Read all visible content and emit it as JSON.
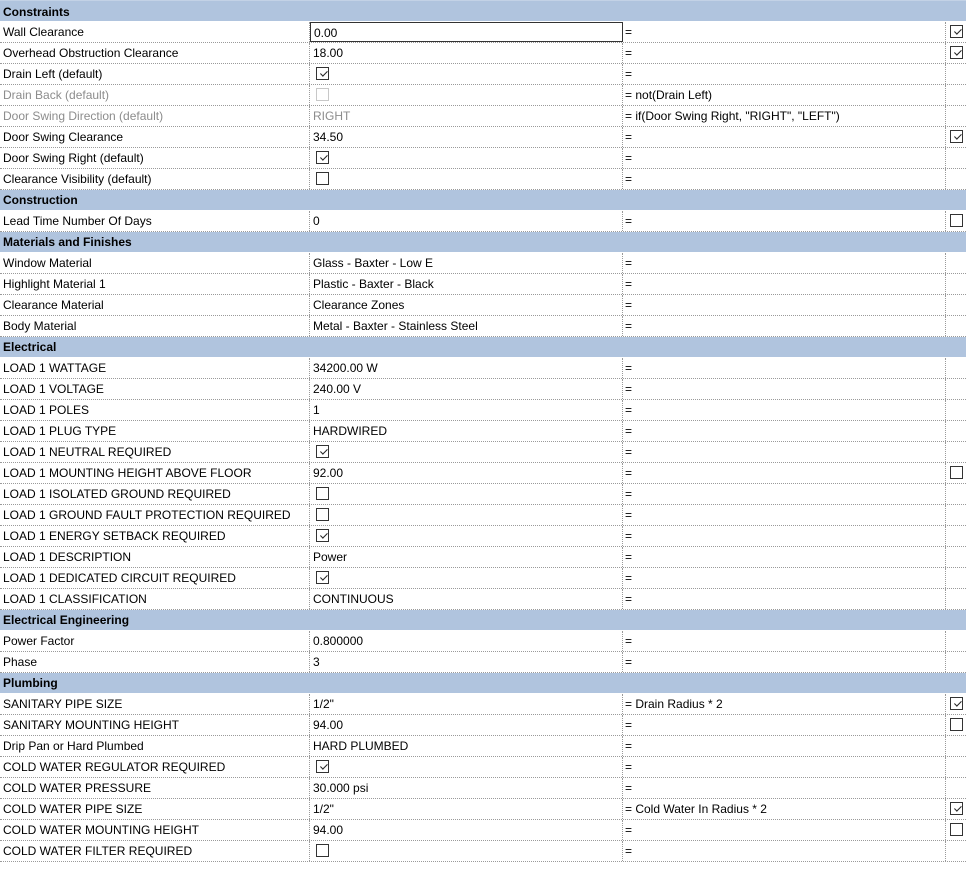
{
  "sections": [
    {
      "title": "Constraints",
      "rows": [
        {
          "name": "Wall Clearance",
          "value": "0.00",
          "formula": "=",
          "reporting": true,
          "active": true
        },
        {
          "name": "Overhead Obstruction Clearance",
          "value": "18.00",
          "formula": "=",
          "reporting": true
        },
        {
          "name": "Drain Left (default)",
          "check": true,
          "formula": "="
        },
        {
          "name": "Drain Back (default)",
          "check": false,
          "disabled": true,
          "formula": "= not(Drain Left)"
        },
        {
          "name": "Door Swing Direction (default)",
          "value": "RIGHT",
          "disabled": true,
          "formula": "= if(Door Swing Right, \"RIGHT\", \"LEFT\")"
        },
        {
          "name": "Door Swing Clearance",
          "value": "34.50",
          "formula": "=",
          "reporting": true
        },
        {
          "name": "Door Swing Right (default)",
          "check": true,
          "formula": "="
        },
        {
          "name": "Clearance Visibility (default)",
          "check": false,
          "formula": "="
        }
      ]
    },
    {
      "title": "Construction",
      "rows": [
        {
          "name": "Lead Time Number Of Days",
          "value": "0",
          "formula": "=",
          "reporting": false
        }
      ]
    },
    {
      "title": "Materials and Finishes",
      "rows": [
        {
          "name": "Window Material",
          "value": "Glass - Baxter - Low E",
          "formula": "="
        },
        {
          "name": "Highlight Material 1",
          "value": "Plastic - Baxter - Black",
          "formula": "="
        },
        {
          "name": "Clearance Material",
          "value": "Clearance Zones",
          "formula": "="
        },
        {
          "name": "Body Material",
          "value": "Metal - Baxter - Stainless Steel",
          "formula": "="
        }
      ]
    },
    {
      "title": "Electrical",
      "rows": [
        {
          "name": "LOAD 1 WATTAGE",
          "value": "34200.00 W",
          "formula": "="
        },
        {
          "name": "LOAD 1 VOLTAGE",
          "value": "240.00 V",
          "formula": "="
        },
        {
          "name": "LOAD 1 POLES",
          "value": "1",
          "formula": "="
        },
        {
          "name": "LOAD 1 PLUG TYPE",
          "value": "HARDWIRED",
          "formula": "="
        },
        {
          "name": "LOAD 1 NEUTRAL REQUIRED",
          "check": true,
          "formula": "="
        },
        {
          "name": "LOAD 1 MOUNTING HEIGHT ABOVE FLOOR",
          "value": "92.00",
          "formula": "=",
          "reporting": false
        },
        {
          "name": "LOAD 1 ISOLATED GROUND REQUIRED",
          "check": false,
          "formula": "="
        },
        {
          "name": "LOAD 1 GROUND FAULT PROTECTION REQUIRED",
          "check": false,
          "formula": "="
        },
        {
          "name": "LOAD 1 ENERGY SETBACK REQUIRED",
          "check": true,
          "formula": "="
        },
        {
          "name": "LOAD 1 DESCRIPTION",
          "value": "Power",
          "formula": "="
        },
        {
          "name": "LOAD 1 DEDICATED CIRCUIT REQUIRED",
          "check": true,
          "formula": "="
        },
        {
          "name": "LOAD 1 CLASSIFICATION",
          "value": "CONTINUOUS",
          "formula": "="
        }
      ]
    },
    {
      "title": "Electrical Engineering",
      "rows": [
        {
          "name": "Power Factor",
          "value": "0.800000",
          "formula": "="
        },
        {
          "name": "Phase",
          "value": "3",
          "formula": "="
        }
      ]
    },
    {
      "title": "Plumbing",
      "rows": [
        {
          "name": "SANITARY PIPE SIZE",
          "value": "1/2\"",
          "formula": "= Drain Radius * 2",
          "reporting": true
        },
        {
          "name": "SANITARY MOUNTING HEIGHT",
          "value": "94.00",
          "formula": "=",
          "reporting": false
        },
        {
          "name": "Drip Pan or Hard Plumbed",
          "value": "HARD PLUMBED",
          "formula": "="
        },
        {
          "name": "COLD WATER REGULATOR REQUIRED",
          "check": true,
          "formula": "="
        },
        {
          "name": "COLD WATER PRESSURE",
          "value": "30.000 psi",
          "formula": "="
        },
        {
          "name": "COLD WATER PIPE SIZE",
          "value": "1/2\"",
          "formula": "= Cold Water In Radius * 2",
          "reporting": true
        },
        {
          "name": "COLD WATER MOUNTING HEIGHT",
          "value": "94.00",
          "formula": "=",
          "reporting": false
        },
        {
          "name": "COLD WATER FILTER REQUIRED",
          "check": false,
          "formula": "="
        }
      ]
    }
  ]
}
